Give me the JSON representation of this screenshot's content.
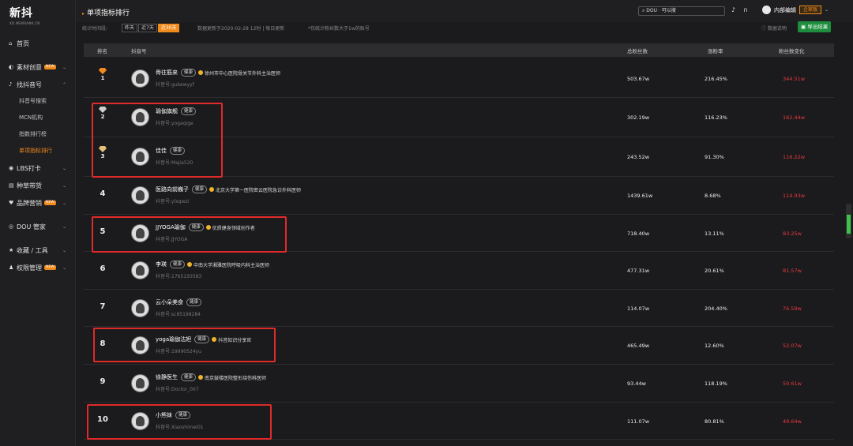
{
  "logo": {
    "main": "新抖",
    "sub": "XD.NEWRANK.CN"
  },
  "sidebar": {
    "home": "首页",
    "material": "素材创意",
    "find_account": "找抖音号",
    "sub_items": [
      "抖音号搜索",
      "MCN机构",
      "指数排行榜",
      "单项指标排行"
    ],
    "lbs": "LBS打卡",
    "goods": "种草带货",
    "brand": "品牌营销",
    "dou": "DOU 管家",
    "favorites": "收藏 / 工具",
    "permission": "权限管理",
    "new_badge": "NEW"
  },
  "topbar": {
    "title": "单项指标排行",
    "search_placeholder": "DOU · 可以搜",
    "username": "内部编辑",
    "plan": "企家版"
  },
  "filter": {
    "label": "统计时间段:",
    "buttons": [
      "昨天",
      "近7天",
      "近30天"
    ],
    "active": "近30天",
    "update": "数据更新于2020-02-28 12时 | 每日更新",
    "note": "*仅统计粉丝数大于1w的账号",
    "help": "数据说明",
    "export": "导出结果"
  },
  "table": {
    "headers": {
      "rank": "排名",
      "account": "抖音号",
      "fans": "总粉丝数",
      "rate": "涨粉率",
      "change": "粉丝数变化"
    },
    "rows": [
      {
        "rank": "1",
        "name": "骨往筋来",
        "cat": "健康",
        "desc": "徐州市中心医院骨关节外科主治医师",
        "id": "抖音号:gukewyyf",
        "fans": "503.67w",
        "rate": "216.45%",
        "chg": "344.51w"
      },
      {
        "rank": "2",
        "name": "瑜伽旗舰",
        "cat": "健康",
        "desc": "",
        "id": "抖音号:yogaqige",
        "fans": "302.19w",
        "rate": "116.23%",
        "chg": "162.44w"
      },
      {
        "rank": "3",
        "name": "佳佳",
        "cat": "健康",
        "desc": "",
        "id": "抖音号:Majia520",
        "fans": "243.52w",
        "rate": "91.30%",
        "chg": "116.22w"
      },
      {
        "rank": "4",
        "name": "医路向前巍子",
        "cat": "健康",
        "desc": "北京大学第一医院密云医院急诊外科医师",
        "id": "抖音号:ylxqwzi",
        "fans": "1439.61w",
        "rate": "8.68%",
        "chg": "114.93w"
      },
      {
        "rank": "5",
        "name": "JJYOGA瑜伽",
        "cat": "健康",
        "desc": "优质健身领域创作者",
        "id": "抖音号:JJYOGA",
        "fans": "718.40w",
        "rate": "13.11%",
        "chg": "83.25w"
      },
      {
        "rank": "6",
        "name": "李瑛",
        "cat": "健康",
        "desc": "中南大学湘雅医院呼吸内科主治医师",
        "id": "抖音号:1765150583",
        "fans": "477.31w",
        "rate": "20.61%",
        "chg": "81.57w"
      },
      {
        "rank": "7",
        "name": "云小朵美食",
        "cat": "健康",
        "desc": "",
        "id": "抖音号:sc85198284",
        "fans": "114.07w",
        "rate": "204.40%",
        "chg": "76.59w"
      },
      {
        "rank": "8",
        "name": "yoga瑜伽沽妲",
        "cat": "健康",
        "desc": "抖音知识分享官",
        "id": "抖音号:19990524yu",
        "fans": "465.49w",
        "rate": "12.60%",
        "chg": "52.07w"
      },
      {
        "rank": "9",
        "name": "徐静医生",
        "cat": "健康",
        "desc": "南京鼓楼医院整形烧伤科医师",
        "id": "抖音号:Doctor_007",
        "fans": "93.44w",
        "rate": "118.19%",
        "chg": "50.61w"
      },
      {
        "rank": "10",
        "name": "小熊妹",
        "cat": "健康",
        "desc": "",
        "id": "抖音号:Xiaoshimei01",
        "fans": "111.07w",
        "rate": "80.81%",
        "chg": "49.64w"
      }
    ]
  },
  "colors": {
    "accent": "#f08a1c",
    "negative": "#e8393d",
    "highlight": "#e02a2a",
    "gold": "#f0b429"
  }
}
